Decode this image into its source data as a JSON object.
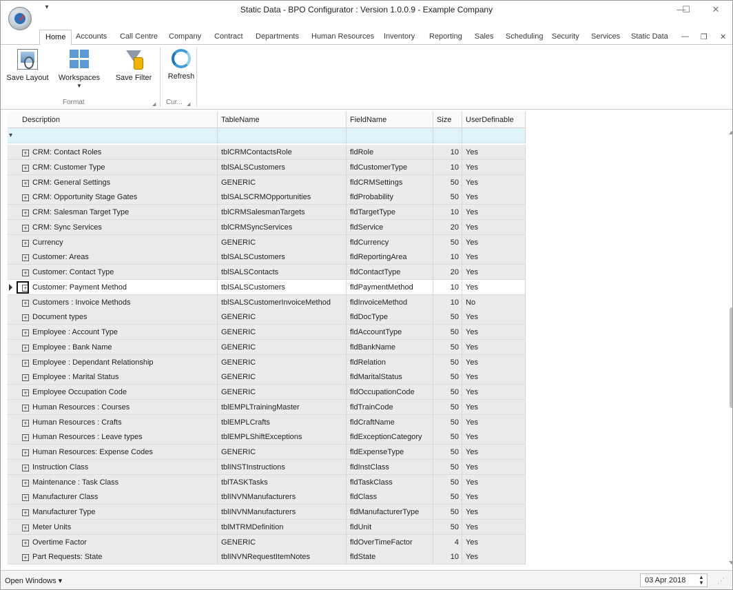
{
  "window": {
    "title": "Static Data - BPO Configurator : Version 1.0.0.9 - Example Company",
    "qat_glyph": "▾",
    "minimize": "—",
    "maximize": "☐",
    "close": "✕"
  },
  "tabs": [
    "Home",
    "Accounts",
    "Call Centre",
    "Company",
    "Contract",
    "Departments",
    "Human Resources",
    "Inventory",
    "Reporting",
    "Sales",
    "Scheduling",
    "Security",
    "Services",
    "Static Data"
  ],
  "mdi": {
    "minimize": "—",
    "restore": "❐",
    "close": "✕"
  },
  "ribbon": {
    "save_layout": "Save Layout",
    "workspaces": "Workspaces",
    "save_filter": "Save Filter",
    "refresh": "Refresh",
    "group_format": "Format",
    "group_current": "Cur...",
    "dropdown_arrow": "▼",
    "launcher": "◢"
  },
  "grid": {
    "columns": [
      "Description",
      "TableName",
      "FieldName",
      "Size",
      "UserDefinable"
    ],
    "filter_icon": "▾",
    "expander_glyph": "+",
    "focused_row_index": 9,
    "rows": [
      {
        "description": "CRM: Contact Roles",
        "table": "tblCRMContactsRole",
        "field": "fldRole",
        "size": "10",
        "user_definable": "Yes"
      },
      {
        "description": "CRM: Customer Type",
        "table": "tblSALSCustomers",
        "field": "fldCustomerType",
        "size": "10",
        "user_definable": "Yes"
      },
      {
        "description": "CRM: General Settings",
        "table": "GENERIC",
        "field": "fldCRMSettings",
        "size": "50",
        "user_definable": "Yes"
      },
      {
        "description": "CRM: Opportunity Stage Gates",
        "table": "tblSALSCRMOpportunities",
        "field": "fldProbability",
        "size": "50",
        "user_definable": "Yes"
      },
      {
        "description": "CRM: Salesman Target Type",
        "table": "tblCRMSalesmanTargets",
        "field": "fldTargetType",
        "size": "10",
        "user_definable": "Yes"
      },
      {
        "description": "CRM: Sync Services",
        "table": "tblCRMSyncServices",
        "field": "fldService",
        "size": "20",
        "user_definable": "Yes"
      },
      {
        "description": "Currency",
        "table": "GENERIC",
        "field": "fldCurrency",
        "size": "50",
        "user_definable": "Yes"
      },
      {
        "description": "Customer: Areas",
        "table": "tblSALSCustomers",
        "field": "fldReportingArea",
        "size": "10",
        "user_definable": "Yes"
      },
      {
        "description": "Customer: Contact Type",
        "table": "tblSALSContacts",
        "field": "fldContactType",
        "size": "20",
        "user_definable": "Yes"
      },
      {
        "description": "Customer: Payment Method",
        "table": "tblSALSCustomers",
        "field": "fldPaymentMethod",
        "size": "10",
        "user_definable": "Yes"
      },
      {
        "description": "Customers : Invoice Methods",
        "table": "tblSALSCustomerInvoiceMethod",
        "field": "fldInvoiceMethod",
        "size": "10",
        "user_definable": "No"
      },
      {
        "description": "Document types",
        "table": "GENERIC",
        "field": "fldDocType",
        "size": "50",
        "user_definable": "Yes"
      },
      {
        "description": "Employee : Account Type",
        "table": "GENERIC",
        "field": "fldAccountType",
        "size": "50",
        "user_definable": "Yes"
      },
      {
        "description": "Employee : Bank Name",
        "table": "GENERIC",
        "field": "fldBankName",
        "size": "50",
        "user_definable": "Yes"
      },
      {
        "description": "Employee : Dependant Relationship",
        "table": "GENERIC",
        "field": "fldRelation",
        "size": "50",
        "user_definable": "Yes"
      },
      {
        "description": "Employee : Marital Status",
        "table": "GENERIC",
        "field": "fldMaritalStatus",
        "size": "50",
        "user_definable": "Yes"
      },
      {
        "description": "Employee Occupation Code",
        "table": "GENERIC",
        "field": "fldOccupationCode",
        "size": "50",
        "user_definable": "Yes"
      },
      {
        "description": "Human Resources : Courses",
        "table": "tblEMPLTrainingMaster",
        "field": "fldTrainCode",
        "size": "50",
        "user_definable": "Yes"
      },
      {
        "description": "Human Resources : Crafts",
        "table": "tblEMPLCrafts",
        "field": "fldCraftName",
        "size": "50",
        "user_definable": "Yes"
      },
      {
        "description": "Human Resources : Leave types",
        "table": "tblEMPLShiftExceptions",
        "field": "fldExceptionCategory",
        "size": "50",
        "user_definable": "Yes"
      },
      {
        "description": "Human Resources: Expense Codes",
        "table": "GENERIC",
        "field": "fldExpenseType",
        "size": "50",
        "user_definable": "Yes"
      },
      {
        "description": "Instruction Class",
        "table": "tblINSTInstructions",
        "field": "fldInstClass",
        "size": "50",
        "user_definable": "Yes"
      },
      {
        "description": "Maintenance : Task Class",
        "table": "tblTASKTasks",
        "field": "fldTaskClass",
        "size": "50",
        "user_definable": "Yes"
      },
      {
        "description": "Manufacturer Class",
        "table": "tblINVNManufacturers",
        "field": "fldClass",
        "size": "50",
        "user_definable": "Yes"
      },
      {
        "description": "Manufacturer Type",
        "table": "tblINVNManufacturers",
        "field": "fldManufacturerType",
        "size": "50",
        "user_definable": "Yes"
      },
      {
        "description": "Meter Units",
        "table": "tblMTRMDefinition",
        "field": "fldUnit",
        "size": "50",
        "user_definable": "Yes"
      },
      {
        "description": "Overtime Factor",
        "table": "GENERIC",
        "field": "fldOverTimeFactor",
        "size": "4",
        "user_definable": "Yes"
      },
      {
        "description": "Part Requests: State",
        "table": "tblINVNRequestItemNotes",
        "field": "fldState",
        "size": "10",
        "user_definable": "Yes"
      }
    ]
  },
  "statusbar": {
    "open_windows": "Open Windows ▾",
    "date": "03 Apr 2018",
    "spin_up": "▲",
    "spin_down": "▼",
    "grip": "⋰"
  }
}
